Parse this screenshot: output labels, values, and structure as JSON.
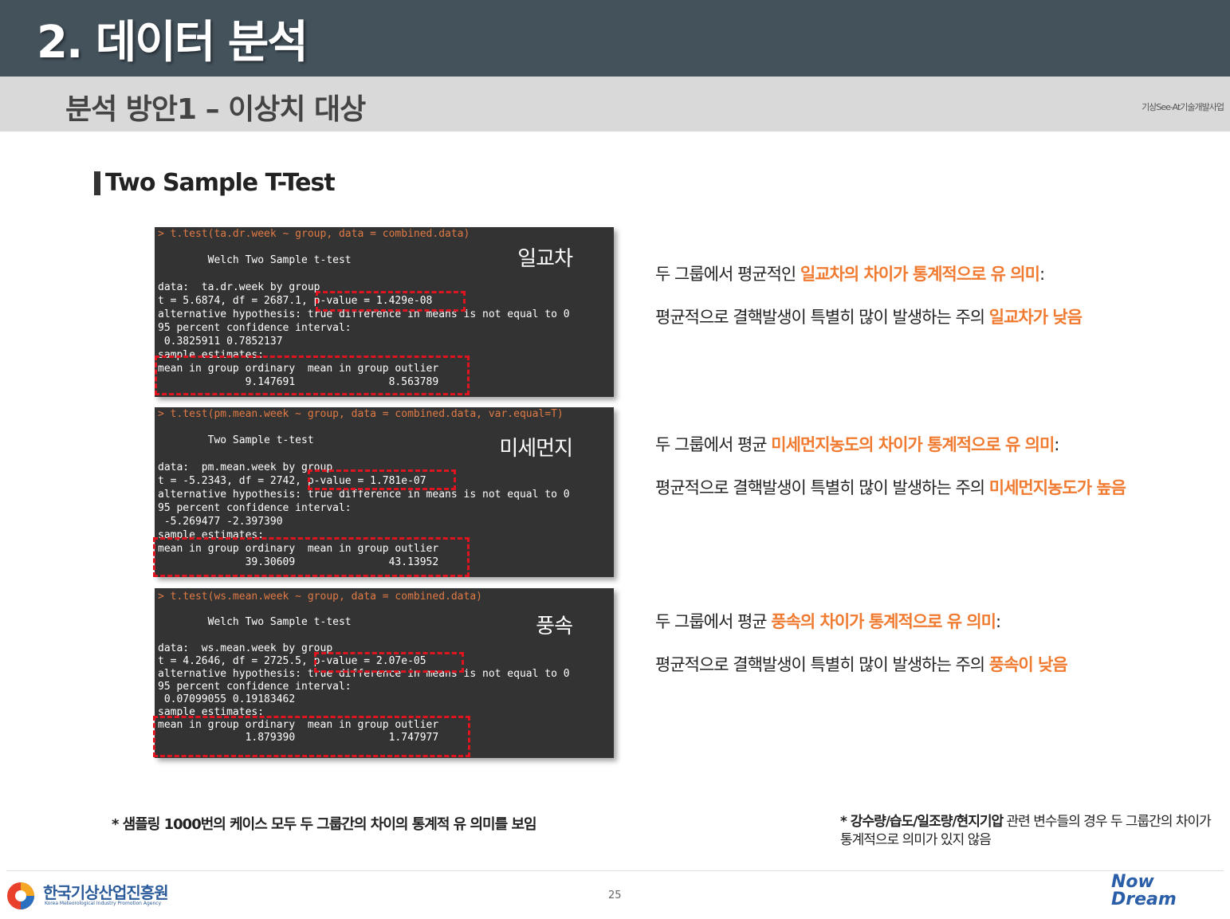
{
  "header": {
    "title": "2. 데이터 분석",
    "subtitle": "분석 방안1 – 이상치 대상",
    "org": "기상See-At기술개발사업"
  },
  "section": {
    "heading": "Two Sample T-Test"
  },
  "consoles": [
    {
      "label": "일교차",
      "lines": [
        "> t.test(ta.dr.week ~ group, data = combined.data)",
        "",
        "        Welch Two Sample t-test",
        "",
        "data:  ta.dr.week by group",
        "t = 5.6874, df = 2687.1, p-value = 1.429e-08",
        "alternative hypothesis: true difference in means is not equal to 0",
        "95 percent confidence interval:",
        " 0.3825911 0.7852137",
        "sample estimates:",
        "mean in group ordinary  mean in group outlier",
        "              9.147691               8.563789"
      ]
    },
    {
      "label": "미세먼지",
      "lines": [
        "> t.test(pm.mean.week ~ group, data = combined.data, var.equal=T)",
        "",
        "        Two Sample t-test",
        "",
        "data:  pm.mean.week by group",
        "t = -5.2343, df = 2742, p-value = 1.781e-07",
        "alternative hypothesis: true difference in means is not equal to 0",
        "95 percent confidence interval:",
        " -5.269477 -2.397390",
        "sample estimates:",
        "mean in group ordinary  mean in group outlier",
        "              39.30609               43.13952"
      ]
    },
    {
      "label": "풍속",
      "lines": [
        "> t.test(ws.mean.week ~ group, data = combined.data)",
        "",
        "        Welch Two Sample t-test",
        "",
        "data:  ws.mean.week by group",
        "t = 4.2646, df = 2725.5, p-value = 2.07e-05",
        "alternative hypothesis: true difference in means is not equal to 0",
        "95 percent confidence interval:",
        " 0.07099055 0.19183462",
        "sample estimates:",
        "mean in group ordinary  mean in group outlier",
        "              1.879390               1.747977"
      ]
    }
  ],
  "descriptions": [
    {
      "line1_pre": "두 그룹에서 평균적인 ",
      "line1_em": "일교차의 차이가 통계적으로 유 의미",
      "line1_post": ":",
      "line2_pre": "평균적으로 결핵발생이 특별히 많이 발생하는 주의 ",
      "line2_em": "일교차가 낮음"
    },
    {
      "line1_pre": "두 그룹에서 평균 ",
      "line1_em": "미세먼지농도의 차이가 통계적으로 유 의미",
      "line1_post": ":",
      "line2_pre": "평균적으로 결핵발생이 특별히 많이 발생하는 주의 ",
      "line2_em": "미세먼지농도가 높음"
    },
    {
      "line1_pre": "두 그룹에서 평균 ",
      "line1_em": "풍속의 차이가 통계적으로 유 의미",
      "line1_post": ":",
      "line2_pre": "평균적으로 결핵발생이 특별히 많이 발생하는 주의 ",
      "line2_em": "풍속이 낮음"
    }
  ],
  "notes": {
    "left": "* 샘플링 1000번의 케이스 모두 두 그룹간의 차이의 통계적 유 의미를 보임",
    "right_bold": "* 강수량/습도/일조량/현지기압",
    "right_rest": " 관련 변수들의 경우 두 그룹간의 차이가 통계적으로 의미가 있지 않음"
  },
  "footer": {
    "org_name": "한국기상산업진흥원",
    "org_en": "Korea Meteorological Industry Promotion Agency",
    "page": "25",
    "logo_line1": "Now",
    "logo_line2": "Dream"
  },
  "colors": {
    "accent": "#f07a30",
    "highlight_box": "#e0141e",
    "console_bg": "#333333",
    "header_bg": "#44525c"
  }
}
